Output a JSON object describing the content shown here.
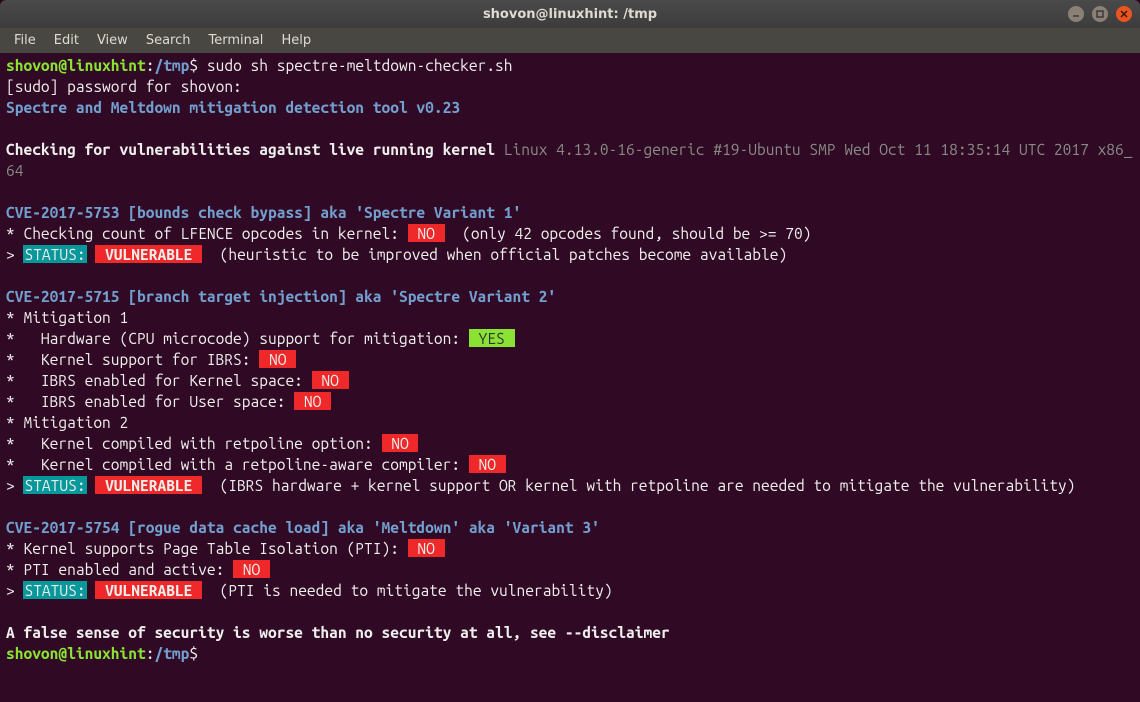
{
  "titlebar": {
    "title": "shovon@linuxhint: /tmp"
  },
  "menubar": {
    "items": [
      "File",
      "Edit",
      "View",
      "Search",
      "Terminal",
      "Help"
    ]
  },
  "prompt": {
    "user_host": "shovon@linuxhint",
    "colon": ":",
    "path": "/tmp",
    "dollar": "$"
  },
  "lines": {
    "cmd1": "sudo sh spectre-meltdown-checker.sh",
    "sudo_prompt": "[sudo] password for shovon:",
    "tool_title": "Spectre and Meltdown mitigation detection tool v0.23",
    "checking_text": "Checking for vulnerabilities against live running kernel",
    "kernel_info": " Linux 4.13.0-16-generic #19-Ubuntu SMP Wed Oct 11 18:35:14 UTC 2017 x86_64",
    "cve1_head": "CVE-2017-5753 [bounds check bypass] aka 'Spectre Variant 1'",
    "cve1_l1a": "* Checking count of LFENCE opcodes in kernel: ",
    "cve1_l1b": "  (only 42 opcodes found, should be >= 70)",
    "cve1_stpre": "> ",
    "status_label": "STATUS:",
    "vulnerable": " VULNERABLE ",
    "cve1_sttail": "  (heuristic to be improved when official patches become available)",
    "cve2_head": "CVE-2017-5715 [branch target injection] aka 'Spectre Variant 2'",
    "mit1": "* Mitigation 1",
    "cve2_l1": "*   Hardware (CPU microcode) support for mitigation: ",
    "yes": " YES ",
    "no": " NO ",
    "cve2_l2": "*   Kernel support for IBRS: ",
    "cve2_l3": "*   IBRS enabled for Kernel space: ",
    "cve2_l4": "*   IBRS enabled for User space: ",
    "mit2": "* Mitigation 2",
    "cve2_l5": "*   Kernel compiled with retpoline option: ",
    "cve2_l6": "*   Kernel compiled with a retpoline-aware compiler: ",
    "cve2_sttail": "  (IBRS hardware + kernel support OR kernel with retpoline are needed to mitigate the vulnerability)",
    "cve3_head": "CVE-2017-5754 [rogue data cache load] aka 'Meltdown' aka 'Variant 3'",
    "cve3_l1": "* Kernel supports Page Table Isolation (PTI): ",
    "cve3_l2": "* PTI enabled and active: ",
    "cve3_sttail": "  (PTI is needed to mitigate the vulnerability)",
    "footer": "A false sense of security is worse than no security at all, see --disclaimer"
  }
}
